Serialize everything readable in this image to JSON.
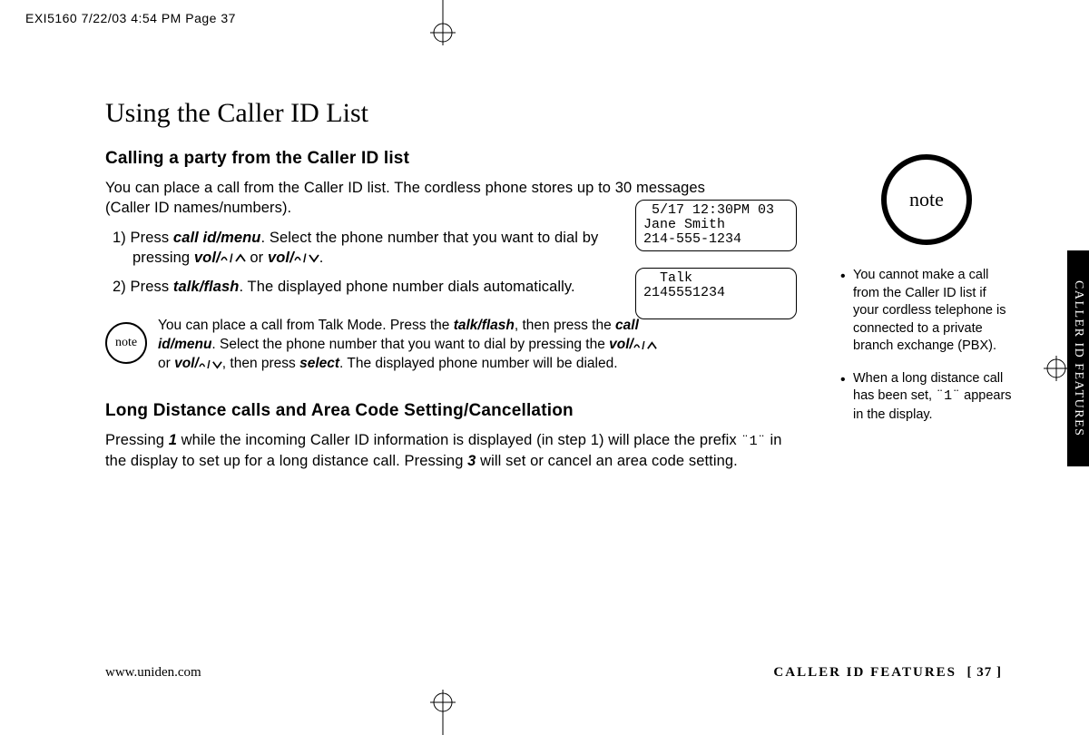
{
  "print_header": "EXI5160  7/22/03 4:54 PM  Page 37",
  "title": "Using the Caller ID List",
  "section1": {
    "heading": "Calling a party from the Caller ID list",
    "intro": "You can place a call from the Caller ID list. The cordless phone stores up to 30 messages (Caller ID names/numbers).",
    "step1_a": "1) Press ",
    "step1_kw1": "call id/menu",
    "step1_b": ". Select the phone number that you want to dial by pressing ",
    "step1_vol1": "vol/",
    "step1_or": " or ",
    "step1_vol2": "vol/",
    "step1_end": ".",
    "step2_a": "2) Press ",
    "step2_kw": "talk/flash",
    "step2_b": ". The displayed phone number dials automatically."
  },
  "lcd1": " 5/17 12:30PM 03\nJane Smith\n214-555-1234",
  "lcd2": "  Talk\n2145551234",
  "note_small_label": "note",
  "note_small_body_a": "You can place a call from Talk Mode. Press the ",
  "note_small_kw1": "talk/flash",
  "note_small_body_b": ", then press the ",
  "note_small_kw2": "call id/menu",
  "note_small_body_c": ". Select the phone number that you want to dial by pressing the ",
  "note_small_vol1": "vol/",
  "note_small_or": " or ",
  "note_small_vol2": "vol/",
  "note_small_body_d": ", then press ",
  "note_small_kw3": "select",
  "note_small_body_e": ". The displayed phone number will be dialed.",
  "section2": {
    "heading": "Long Distance calls and Area Code Setting/Cancellation",
    "body_a": "Pressing ",
    "body_kw1": "1",
    "body_b": " while the incoming Caller ID information is displayed (in step 1) will place the prefix ",
    "body_mono": "¨1¨",
    "body_c": " in the display to set up for a long distance call. Pressing ",
    "body_kw2": "3",
    "body_d": " will set or cancel an area code setting."
  },
  "sidebar": {
    "note_label": "note",
    "items": [
      "You cannot make a call from the Caller ID list if your cordless telephone is connected to a private branch exchange (PBX).",
      "When a long distance call has been set, ¨1¨ appears in the display."
    ]
  },
  "side_tab": "CALLER ID FEATURES",
  "footer": {
    "left": "www.uniden.com",
    "right_label": "CALLER ID FEATURES",
    "page_num": "[ 37 ]"
  }
}
